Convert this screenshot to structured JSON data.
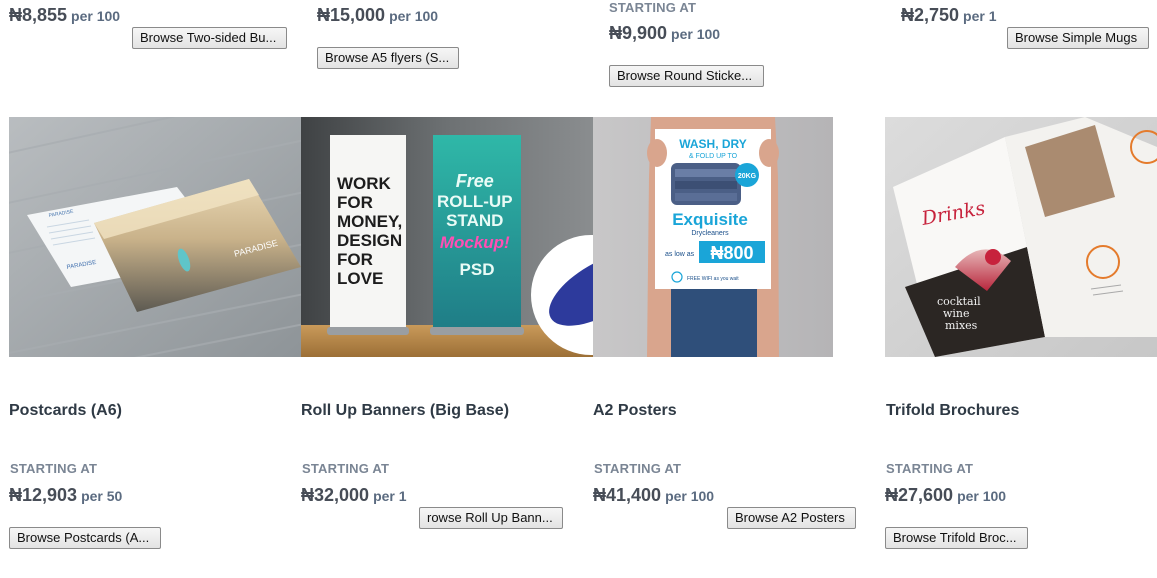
{
  "top_row": [
    {
      "price": "₦8,855",
      "per": "per 100",
      "button": "Browse Two-sided Bu..."
    },
    {
      "price": "₦15,000",
      "per": "per 100",
      "button": "Browse A5 flyers (S..."
    },
    {
      "starting": "STARTING AT",
      "price": "₦9,900",
      "per": "per 100",
      "button": "Browse Round Sticke..."
    },
    {
      "price": "₦2,750",
      "per": "per 1",
      "button": "Browse Simple Mugs"
    }
  ],
  "products": [
    {
      "title": "Postcards (A6)",
      "starting": "STARTING AT",
      "price": "₦12,903",
      "per": "per 50",
      "button": "Browse Postcards (A...",
      "image_text": {
        "heading": "PARADISE",
        "left_caption": "PARADISE"
      }
    },
    {
      "title": "Roll Up Banners (Big Base)",
      "starting": "STARTING AT",
      "price": "₦32,000",
      "per": "per 1",
      "button": "rowse Roll Up Bann...",
      "image_text": {
        "left_banner": [
          "WORK",
          "FOR",
          "MONEY,",
          "DESIGN",
          "FOR",
          "LOVE"
        ],
        "right_banner": [
          "Free",
          "ROLL-UP",
          "STAND",
          "Mockup!",
          "PSD"
        ]
      }
    },
    {
      "title": "A2 Posters",
      "starting": "STARTING AT",
      "price": "₦41,400",
      "per": "per 100",
      "button": "Browse A2 Posters",
      "image_text": {
        "line1": "WASH, DRY",
        "line2": "& FOLD UP TO",
        "badge": "20KG",
        "brand": "Exquisite",
        "sub": "Drycleaners",
        "as_low_as": "as low as",
        "offer": "₦800",
        "footer": "FREE WIFI as you wait"
      }
    },
    {
      "title": "Trifold Brochures",
      "starting": "STARTING AT",
      "price": "₦27,600",
      "per": "per 100",
      "button": "Browse Trifold Broc...",
      "image_text": {
        "heading": "Drinks",
        "caption": [
          "cocktail",
          "wine",
          "mixes"
        ]
      }
    }
  ],
  "colors": {
    "price": "#474d57",
    "per": "#5b6b80",
    "starting": "#7a8594",
    "title": "#2f3a45"
  }
}
